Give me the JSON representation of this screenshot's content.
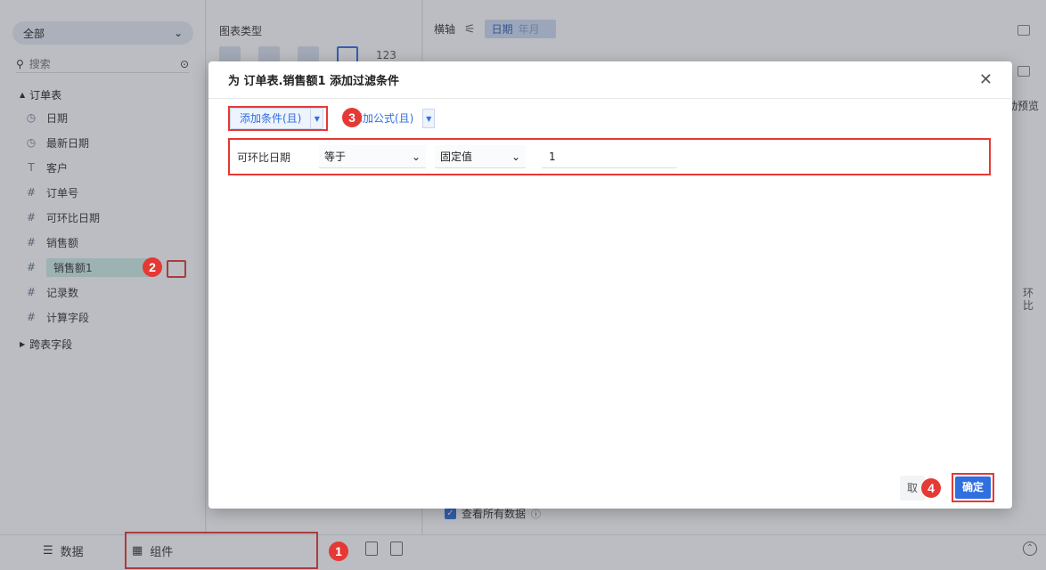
{
  "left_panel": {
    "scope": "全部",
    "search_placeholder": "搜索",
    "table_group": "订单表",
    "fields": [
      {
        "icon": "◷",
        "label": "日期"
      },
      {
        "icon": "◷",
        "label": "最新日期"
      },
      {
        "icon": "T",
        "label": "客户"
      },
      {
        "icon": "#",
        "label": "订单号"
      },
      {
        "icon": "#",
        "label": "可环比日期"
      },
      {
        "icon": "#",
        "label": "销售额"
      },
      {
        "icon": "#",
        "label": "销售额1"
      },
      {
        "icon": "#",
        "label": "记录数"
      },
      {
        "icon": "#",
        "label": "计算字段"
      }
    ],
    "cross_table_group": "跨表字段"
  },
  "mid_panel": {
    "title": "图表类型",
    "number_type_label": "123"
  },
  "right_panel": {
    "axis_label": "横轴",
    "axis_field": "日期",
    "axis_field_sub": "年月",
    "preview_label": "动预览",
    "side_text": "环比",
    "view_all_label": "查看所有数据"
  },
  "bottom_bar": {
    "data_tab": "数据",
    "component_tab": "组件"
  },
  "modal": {
    "title": "为 订单表.销售额1 添加过滤条件",
    "add_condition_label": "添加条件(且)",
    "add_formula_label": "添加公式(且)",
    "condition": {
      "field": "可环比日期",
      "operator": "等于",
      "value_type": "固定值",
      "value": "1"
    },
    "cancel_label": "取",
    "ok_label": "确定"
  },
  "steps": [
    "1",
    "2",
    "3",
    "4"
  ],
  "colors": {
    "accent": "#2f6fe0",
    "highlight": "#e53935"
  }
}
